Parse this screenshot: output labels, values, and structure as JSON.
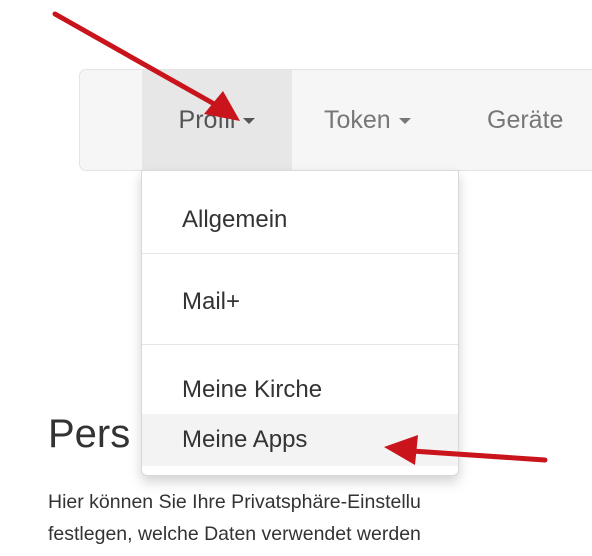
{
  "navbar": {
    "items": [
      {
        "label": "Profil"
      },
      {
        "label": "Token"
      },
      {
        "label": "Geräte"
      }
    ]
  },
  "dropdown": {
    "items": [
      {
        "label": "Allgemein"
      },
      {
        "label": "Mail+"
      },
      {
        "label": "Meine Kirche"
      },
      {
        "label": "Meine Apps"
      }
    ]
  },
  "page": {
    "heading": "Pers",
    "text_line_1": "Hier können Sie Ihre Privatsphäre-Einstellu",
    "text_line_2": "festlegen, welche Daten verwendet werden"
  },
  "colors": {
    "arrow": "#c8141a",
    "navbar_bg": "#f6f6f6",
    "active_bg": "#e7e7e7",
    "highlight_bg": "#f3f3f3"
  }
}
